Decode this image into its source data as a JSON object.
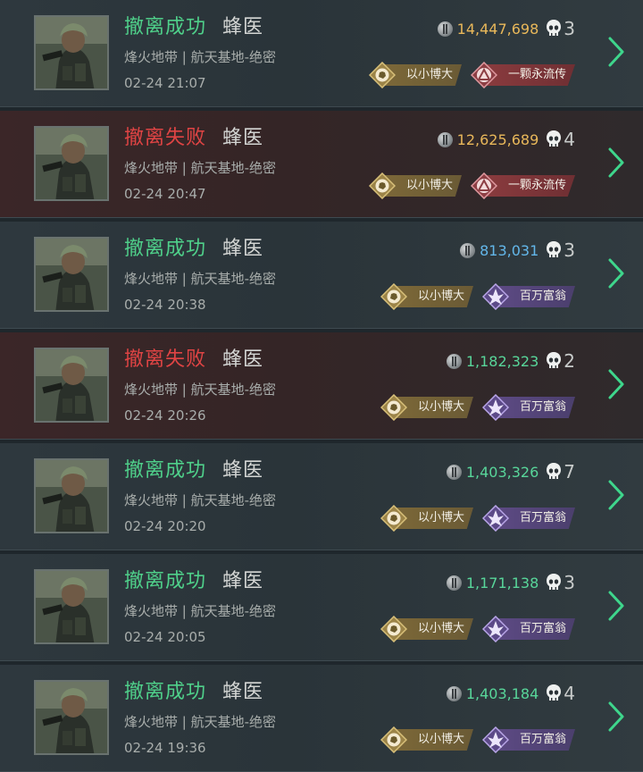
{
  "matches": [
    {
      "status": "撤离成功",
      "result": "success",
      "operator": "蜂医",
      "map": "烽火地带 | 航天基地-绝密",
      "time": "02-24 21:07",
      "value": "14,447,698",
      "value_color": "gold",
      "kills": "3",
      "badges": [
        {
          "label": "以小博大",
          "style": "gold"
        },
        {
          "label": "一颗永流传",
          "style": "red"
        }
      ]
    },
    {
      "status": "撤离失败",
      "result": "fail",
      "operator": "蜂医",
      "map": "烽火地带 | 航天基地-绝密",
      "time": "02-24 20:47",
      "value": "12,625,689",
      "value_color": "gold",
      "kills": "4",
      "badges": [
        {
          "label": "以小博大",
          "style": "gold"
        },
        {
          "label": "一颗永流传",
          "style": "red"
        }
      ]
    },
    {
      "status": "撤离成功",
      "result": "success",
      "operator": "蜂医",
      "map": "烽火地带 | 航天基地-绝密",
      "time": "02-24 20:38",
      "value": "813,031",
      "value_color": "blue",
      "kills": "3",
      "badges": [
        {
          "label": "以小博大",
          "style": "gold"
        },
        {
          "label": "百万富翁",
          "style": "purple"
        }
      ]
    },
    {
      "status": "撤离失败",
      "result": "fail",
      "operator": "蜂医",
      "map": "烽火地带 | 航天基地-绝密",
      "time": "02-24 20:26",
      "value": "1,182,323",
      "value_color": "green",
      "kills": "2",
      "badges": [
        {
          "label": "以小博大",
          "style": "gold"
        },
        {
          "label": "百万富翁",
          "style": "purple"
        }
      ]
    },
    {
      "status": "撤离成功",
      "result": "success",
      "operator": "蜂医",
      "map": "烽火地带 | 航天基地-绝密",
      "time": "02-24 20:20",
      "value": "1,403,326",
      "value_color": "green",
      "kills": "7",
      "badges": [
        {
          "label": "以小博大",
          "style": "gold"
        },
        {
          "label": "百万富翁",
          "style": "purple"
        }
      ]
    },
    {
      "status": "撤离成功",
      "result": "success",
      "operator": "蜂医",
      "map": "烽火地带 | 航天基地-绝密",
      "time": "02-24 20:05",
      "value": "1,171,138",
      "value_color": "green",
      "kills": "3",
      "badges": [
        {
          "label": "以小博大",
          "style": "gold"
        },
        {
          "label": "百万富翁",
          "style": "purple"
        }
      ]
    },
    {
      "status": "撤离成功",
      "result": "success",
      "operator": "蜂医",
      "map": "烽火地带 | 航天基地-绝密",
      "time": "02-24 19:36",
      "value": "1,403,184",
      "value_color": "green",
      "kills": "4",
      "badges": [
        {
          "label": "以小博大",
          "style": "gold"
        },
        {
          "label": "百万富翁",
          "style": "purple"
        }
      ]
    }
  ],
  "colors": {
    "success": "#4fd08a",
    "fail": "#e04444",
    "accent_chevron": "#3ed68c",
    "value_gold": "#e9b85a",
    "value_blue": "#63b7ea",
    "value_green": "#58d69a"
  },
  "icons": {
    "coin": "coin-icon",
    "kills": "skull-icon",
    "badge_gold": "fist-emblem-icon",
    "badge_red": "triangle-emblem-icon",
    "badge_purple": "crystal-emblem-icon",
    "open": "chevron-right-icon"
  }
}
